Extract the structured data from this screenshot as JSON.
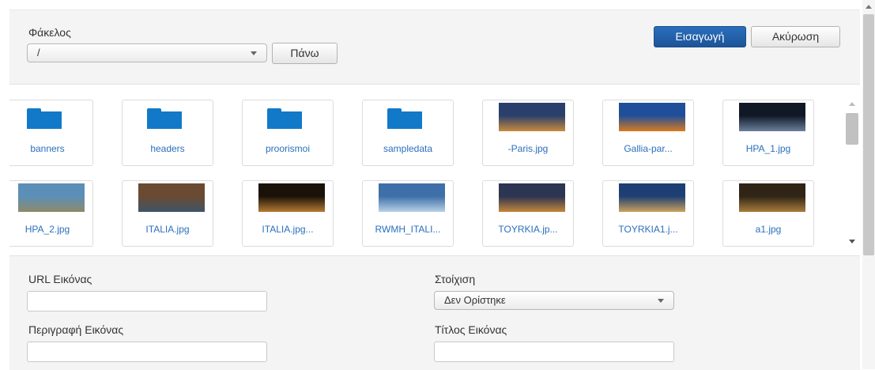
{
  "folder_bar": {
    "label": "Φάκελος",
    "selected": "/",
    "up_label": "Πάνω"
  },
  "actions": {
    "insert_label": "Εισαγωγή",
    "cancel_label": "Ακύρωση"
  },
  "items": [
    {
      "type": "folder",
      "label": "banners"
    },
    {
      "type": "folder",
      "label": "headers"
    },
    {
      "type": "folder",
      "label": "proorismoi"
    },
    {
      "type": "folder",
      "label": "sampledata"
    },
    {
      "type": "image",
      "label": "-Paris.jpg",
      "colors": [
        "#2a3f6b",
        "#c98a3c"
      ]
    },
    {
      "type": "image",
      "label": "Gallia-par...",
      "colors": [
        "#1f4f9a",
        "#d97a1e"
      ]
    },
    {
      "type": "image",
      "label": "HPA_1.jpg",
      "colors": [
        "#101826",
        "#6a7f9c"
      ]
    },
    {
      "type": "image",
      "label": "HPA_2.jpg",
      "colors": [
        "#5b8fb7",
        "#8f8a6a"
      ]
    },
    {
      "type": "image",
      "label": "ITALIA.jpg",
      "colors": [
        "#6b4a32",
        "#3d5568"
      ]
    },
    {
      "type": "image",
      "label": "ITALIA.jpg...",
      "colors": [
        "#1a1208",
        "#b57a34"
      ]
    },
    {
      "type": "image",
      "label": "RWMH_ITALI...",
      "colors": [
        "#3e6fa8",
        "#b7d1e6"
      ]
    },
    {
      "type": "image",
      "label": "TOYRKIA.jp...",
      "colors": [
        "#2c3552",
        "#c4853b"
      ]
    },
    {
      "type": "image",
      "label": "TOYRKIA1.j...",
      "colors": [
        "#1e3f73",
        "#caa15c"
      ]
    },
    {
      "type": "image",
      "label": "a1.jpg",
      "colors": [
        "#2f2416",
        "#a87b3c"
      ]
    }
  ],
  "form": {
    "url_label": "URL Εικόνας",
    "url_value": "",
    "align_label": "Στοίχιση",
    "align_value": "Δεν Ορίστηκε",
    "desc_label": "Περιγραφή Εικόνας",
    "desc_value": "",
    "title_label": "Τίτλος Εικόνας",
    "title_value": ""
  }
}
